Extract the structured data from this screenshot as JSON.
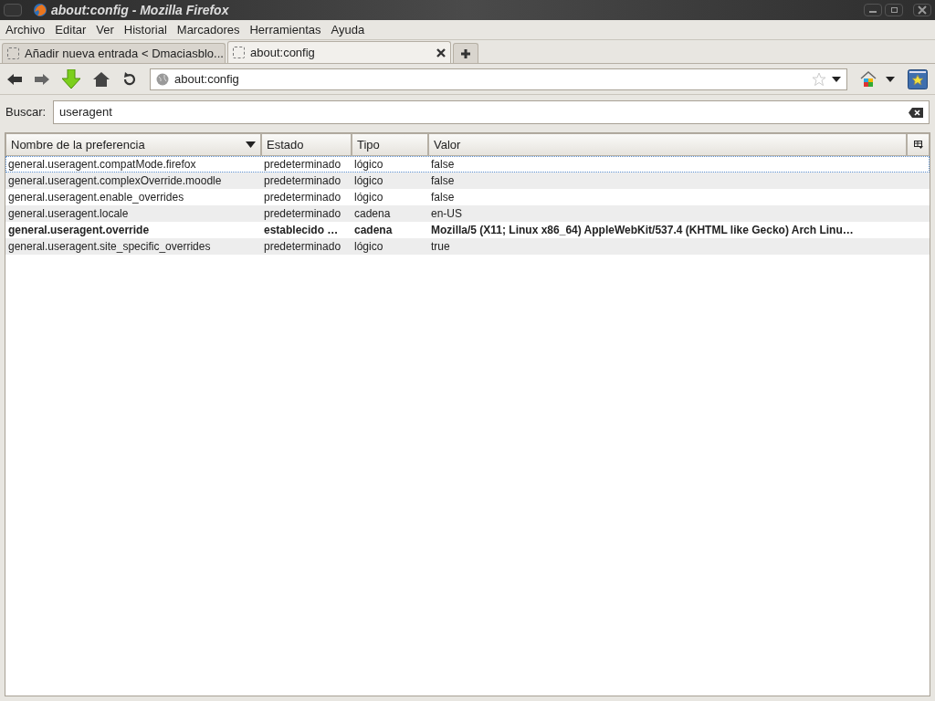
{
  "window": {
    "title": "about:config - Mozilla Firefox"
  },
  "menu": [
    "Archivo",
    "Editar",
    "Ver",
    "Historial",
    "Marcadores",
    "Herramientas",
    "Ayuda"
  ],
  "tabs": [
    {
      "label": "Añadir nueva entrada < Dmaciasblo...",
      "selected": false
    },
    {
      "label": "about:config",
      "selected": true
    }
  ],
  "address_bar": {
    "value": "about:config"
  },
  "search": {
    "label": "Buscar:",
    "value": "useragent"
  },
  "table": {
    "columns": [
      "Nombre de la preferencia",
      "Estado",
      "Tipo",
      "Valor"
    ],
    "rows": [
      {
        "name": "general.useragent.compatMode.firefox",
        "state": "predeterminado",
        "type": "lógico",
        "value": "false",
        "modified": false,
        "selected": true
      },
      {
        "name": "general.useragent.complexOverride.moodle",
        "state": "predeterminado",
        "type": "lógico",
        "value": "false",
        "modified": false,
        "selected": false
      },
      {
        "name": "general.useragent.enable_overrides",
        "state": "predeterminado",
        "type": "lógico",
        "value": "false",
        "modified": false,
        "selected": false
      },
      {
        "name": "general.useragent.locale",
        "state": "predeterminado",
        "type": "cadena",
        "value": "en-US",
        "modified": false,
        "selected": false
      },
      {
        "name": "general.useragent.override",
        "state": "establecido …",
        "type": "cadena",
        "value": "Mozilla/5 (X11; Linux x86_64) AppleWebKit/537.4 (KHTML like Gecko) Arch Linu…",
        "modified": true,
        "selected": false
      },
      {
        "name": "general.useragent.site_specific_overrides",
        "state": "predeterminado",
        "type": "lógico",
        "value": "true",
        "modified": false,
        "selected": false
      }
    ]
  }
}
